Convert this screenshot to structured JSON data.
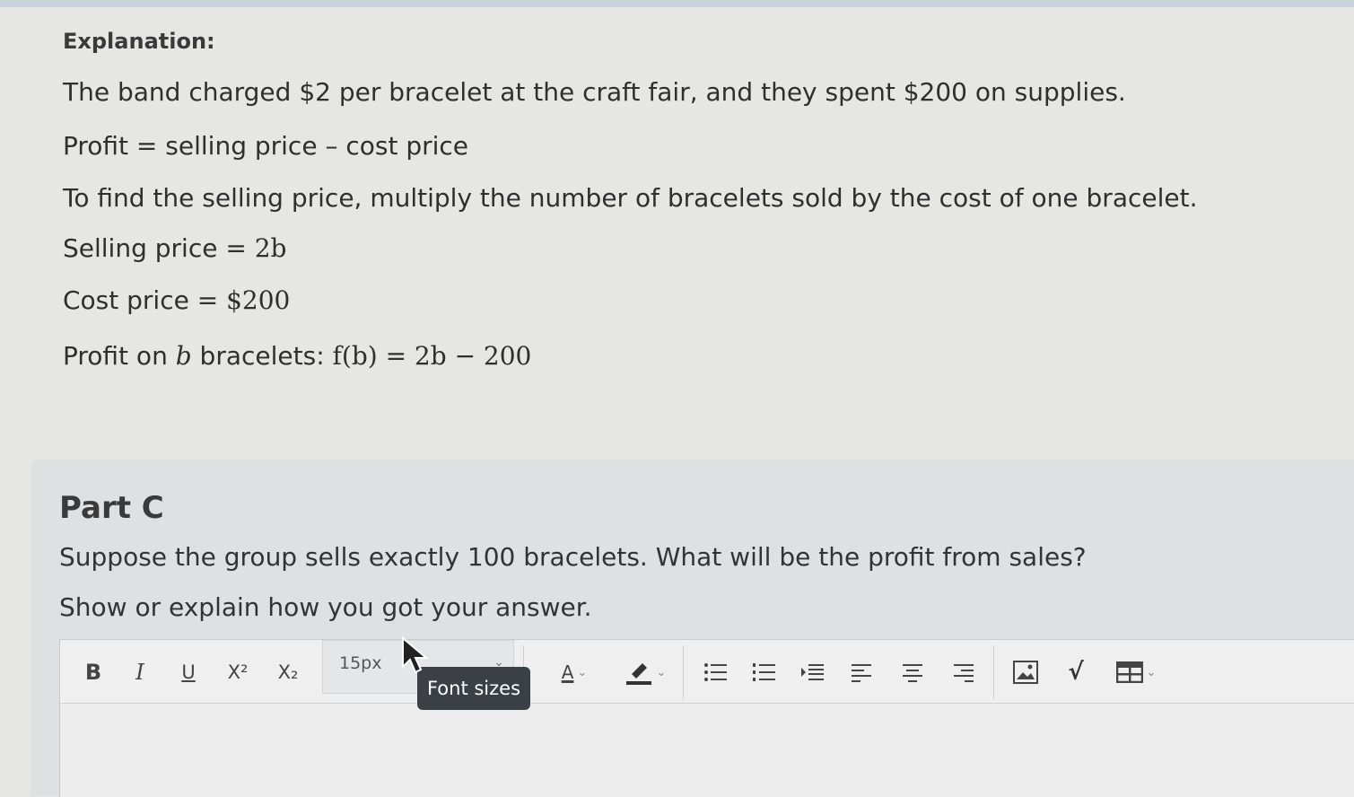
{
  "explanation": {
    "heading": "Explanation:",
    "line1": "The band charged $2 per bracelet at the craft fair, and they spent $200 on supplies.",
    "line2": "Profit = selling price – cost price",
    "line3": "To find the selling price, multiply the number of bracelets sold by the cost of one bracelet.",
    "line4_label": "Selling price = ",
    "line4_value": "2b",
    "line5_label": "Cost price = ",
    "line5_value": "$200",
    "line6_label_a": "Profit on ",
    "line6_var": "b",
    "line6_label_b": " bracelets: ",
    "line6_formula": "f(b) = 2b − 200"
  },
  "part_c": {
    "title": "Part C",
    "question": "Suppose the group sells exactly 100 bracelets. What will be the profit from sales?",
    "instruction": "Show or explain how you got your answer."
  },
  "toolbar": {
    "bold_label": "B",
    "italic_label": "I",
    "underline_label": "U",
    "superscript_label": "X²",
    "subscript_label": "X₂",
    "font_size_value": "15px",
    "font_size_tooltip": "Font sizes",
    "font_color_label": "A",
    "icons": [
      "bold-icon",
      "italic-icon",
      "underline-icon",
      "superscript-icon",
      "subscript-icon",
      "font-color-icon",
      "highlight-icon",
      "bullet-list-icon",
      "numbered-list-icon",
      "indent-icon",
      "align-left-icon",
      "align-center-icon",
      "align-right-icon",
      "image-icon",
      "math-icon",
      "table-icon"
    ]
  },
  "colors": {
    "page_bg": "#e6e6e3",
    "panel_bg": "#dfe0e2",
    "tooltip_bg": "#3b4046"
  }
}
